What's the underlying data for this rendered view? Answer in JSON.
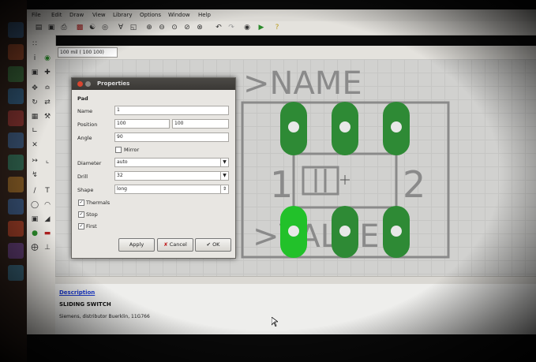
{
  "menu": {
    "file": "File",
    "edit": "Edit",
    "draw": "Draw",
    "view": "View",
    "library": "Library",
    "options": "Options",
    "window": "Window",
    "help": "Help"
  },
  "parambar": {
    "coordinate": "100 mil ( 100  100)"
  },
  "package": {
    "name_text": ">NAME",
    "value_text": ">VALUE",
    "pin1_label": "1",
    "pin2_label": "2"
  },
  "description": {
    "link": "Description",
    "title": "SLIDING SWITCH",
    "text": "Siemens, distributor Buerklin, 11G766"
  },
  "dialog": {
    "title": "Properties",
    "section": "Pad",
    "name_label": "Name",
    "name_value": "1",
    "position_label": "Position",
    "position_x": "100",
    "position_y": "100",
    "angle_label": "Angle",
    "angle_value": "90",
    "mirror_label": "Mirror",
    "diameter_label": "Diameter",
    "diameter_value": "auto",
    "drill_label": "Drill",
    "drill_value": "32",
    "shape_label": "Shape",
    "shape_value": "long",
    "thermals_label": "Thermals",
    "stop_label": "Stop",
    "first_label": "First",
    "apply_label": "Apply",
    "cancel_label": "Cancel",
    "ok_label": "OK"
  },
  "colors": {
    "pad": "#2e8a35",
    "pad_selected": "#22c12a",
    "outline": "#8a8a8a",
    "title_bar": "#3e3c39",
    "link": "#1c3bd2"
  }
}
